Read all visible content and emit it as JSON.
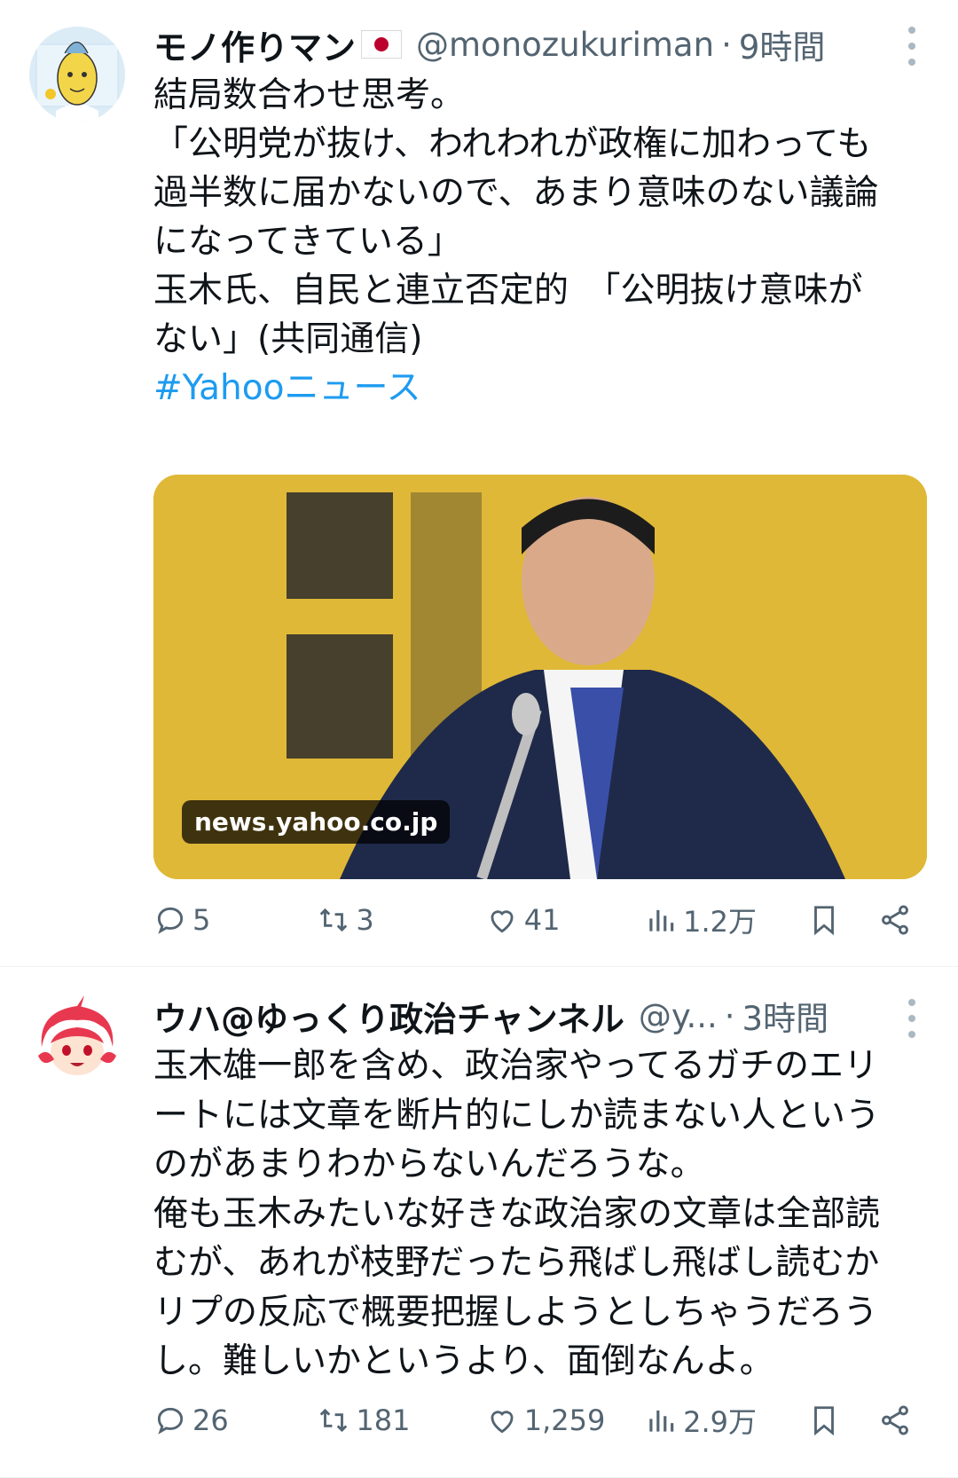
{
  "tweets": [
    {
      "author_name": "モノ作りマン",
      "author_flag": "japan-flag-icon",
      "handle": "@monozukuriman",
      "separator": "·",
      "time": "9時間",
      "text_lines": [
        "結局数合わせ思考。",
        "「公明党が抜け、われわれが政権に加わっても",
        "過半数に届かないので、あまり意味のない議論",
        "になってきている」",
        "",
        "玉木氏、自民と連立否定的　「公明抜け意味が",
        "ない」(共同通信)"
      ],
      "hashtag": "#Yahooニュース",
      "card": {
        "domain": "news.yahoo.co.jp"
      },
      "actions": {
        "replies": "5",
        "retweets": "3",
        "likes": "41",
        "views": "1.2万"
      }
    },
    {
      "author_name": "ウハ@ゆっくり政治チャンネル",
      "handle": "@y...",
      "separator": "·",
      "time": "3時間",
      "text_lines": [
        "玉木雄一郎を含め、政治家やってるガチのエリ",
        "ートには文章を断片的にしか読まない人という",
        "のがあまりわからないんだろうな。",
        "俺も玉木みたいな好きな政治家の文章は全部読",
        "むが、あれが枝野だったら飛ばし飛ばし読むか",
        "リプの反応で概要把握しようとしちゃうだろう",
        "し。難しいかというより、面倒なんよ。"
      ],
      "actions": {
        "replies": "26",
        "retweets": "181",
        "likes": "1,259",
        "views": "2.9万"
      }
    }
  ],
  "colors": {
    "link": "#1d9bf0",
    "secondary_text": "#536471",
    "primary_text": "#0f1419"
  }
}
